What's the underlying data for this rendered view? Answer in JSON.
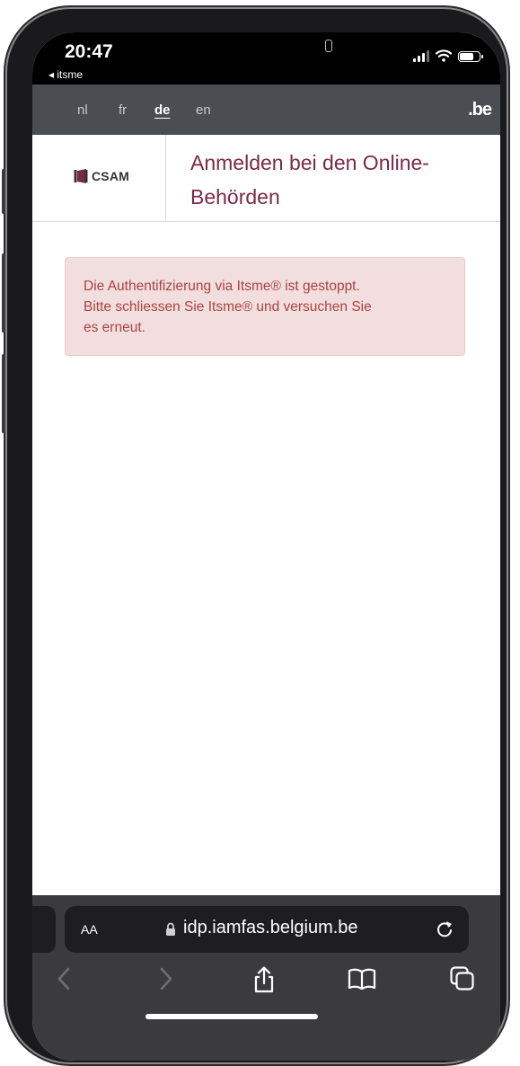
{
  "status_bar": {
    "time": "20:47",
    "back_app": "◂ itsme"
  },
  "lang_bar": {
    "languages": [
      "nl",
      "fr",
      "de",
      "en"
    ],
    "active": "de",
    "logo": ".be"
  },
  "header": {
    "logo_text": "CSAM",
    "title_line1": "Anmelden bei den Online-",
    "title_line2": "Behörden"
  },
  "alert": {
    "line1": "Die Authentifizierung via Itsme® ist gestoppt.",
    "line2": "Bitte schliessen Sie Itsme® und versuchen Sie",
    "line3": "es erneut."
  },
  "safari": {
    "text_size_label": "AA",
    "url": "idp.iamfas.belgium.be"
  },
  "colors": {
    "title": "#7a2a44",
    "alert_bg": "#f2dede",
    "alert_text": "#a94442",
    "lang_bar_bg": "#4a4d51"
  }
}
